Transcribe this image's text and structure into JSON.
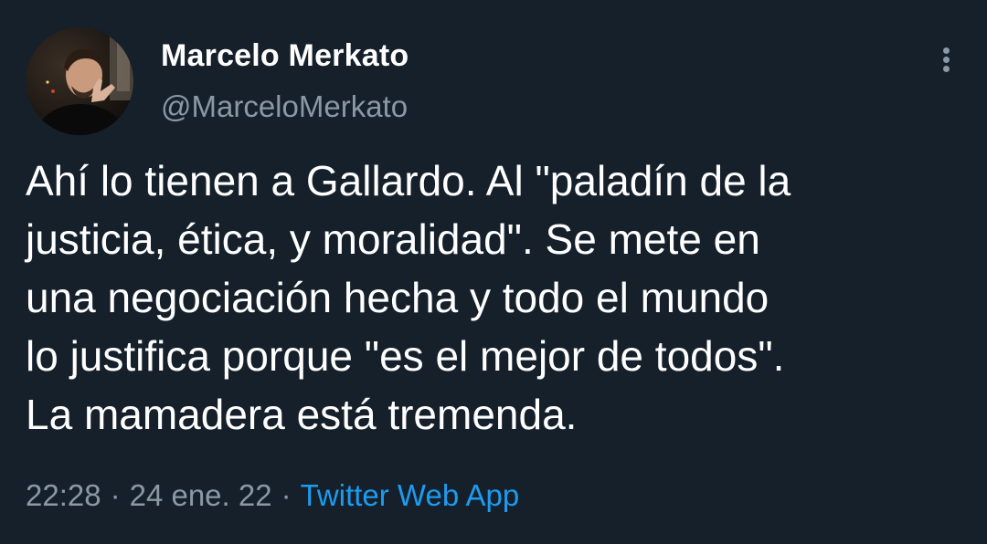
{
  "author": {
    "display_name": "Marcelo Merkato",
    "handle": "@MarceloMerkato",
    "avatar_icon": "user-avatar"
  },
  "tweet": {
    "lines": [
      "Ahí lo tienen a Gallardo. Al \"paladín de la",
      "justicia, ética, y moralidad\". Se mete en",
      "una negociación hecha y todo el mundo",
      "lo justifica porque \"es el mejor de todos\".",
      "La mamadera está tremenda."
    ]
  },
  "meta": {
    "time": "22:28",
    "separator": "·",
    "date": "24 ene. 22",
    "source": "Twitter Web App"
  },
  "colors": {
    "background": "#15202b",
    "primary_text": "#ffffff",
    "secondary_text": "#8b98a5",
    "link": "#1d9bf0"
  }
}
